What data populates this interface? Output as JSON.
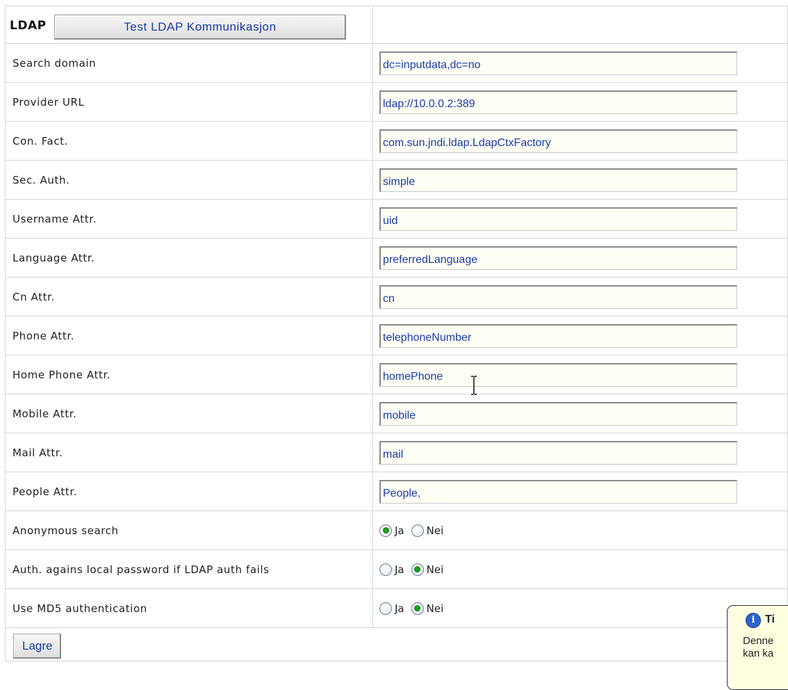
{
  "header": {
    "title": "LDAP",
    "test_button": "Test LDAP Kommunikasjon"
  },
  "fields": [
    {
      "label": "Search domain",
      "value": "dc=inputdata,dc=no"
    },
    {
      "label": "Provider URL",
      "value": "ldap://10.0.0.2:389"
    },
    {
      "label": "Con. Fact.",
      "value": "com.sun.jndi.ldap.LdapCtxFactory"
    },
    {
      "label": "Sec. Auth.",
      "value": "simple"
    },
    {
      "label": "Username Attr.",
      "value": "uid"
    },
    {
      "label": "Language Attr.",
      "value": "preferredLanguage"
    },
    {
      "label": "Cn Attr.",
      "value": "cn"
    },
    {
      "label": "Phone Attr.",
      "value": "telephoneNumber"
    },
    {
      "label": "Home Phone Attr.",
      "value": "homePhone"
    },
    {
      "label": "Mobile Attr.",
      "value": "mobile"
    },
    {
      "label": "Mail Attr.",
      "value": "mail"
    },
    {
      "label": "People Attr.",
      "value": "People,"
    }
  ],
  "options": [
    {
      "label": "Anonymous search",
      "yes": "Ja",
      "no": "Nei",
      "selected": "yes"
    },
    {
      "label": "Auth. agains local password if LDAP auth fails",
      "yes": "Ja",
      "no": "Nei",
      "selected": "no"
    },
    {
      "label": "Use MD5 authentication",
      "yes": "Ja",
      "no": "Nei",
      "selected": "no"
    }
  ],
  "footer": {
    "save_button": "Lagre"
  },
  "tooltip": {
    "icon": "info-icon",
    "title": "Ti",
    "body_line1": "Denne",
    "body_line2": "kan ka"
  },
  "colors": {
    "input_text": "#1a3aa8",
    "radio_selected": "#1aa51a",
    "tooltip_bg": "#ffffe1"
  }
}
